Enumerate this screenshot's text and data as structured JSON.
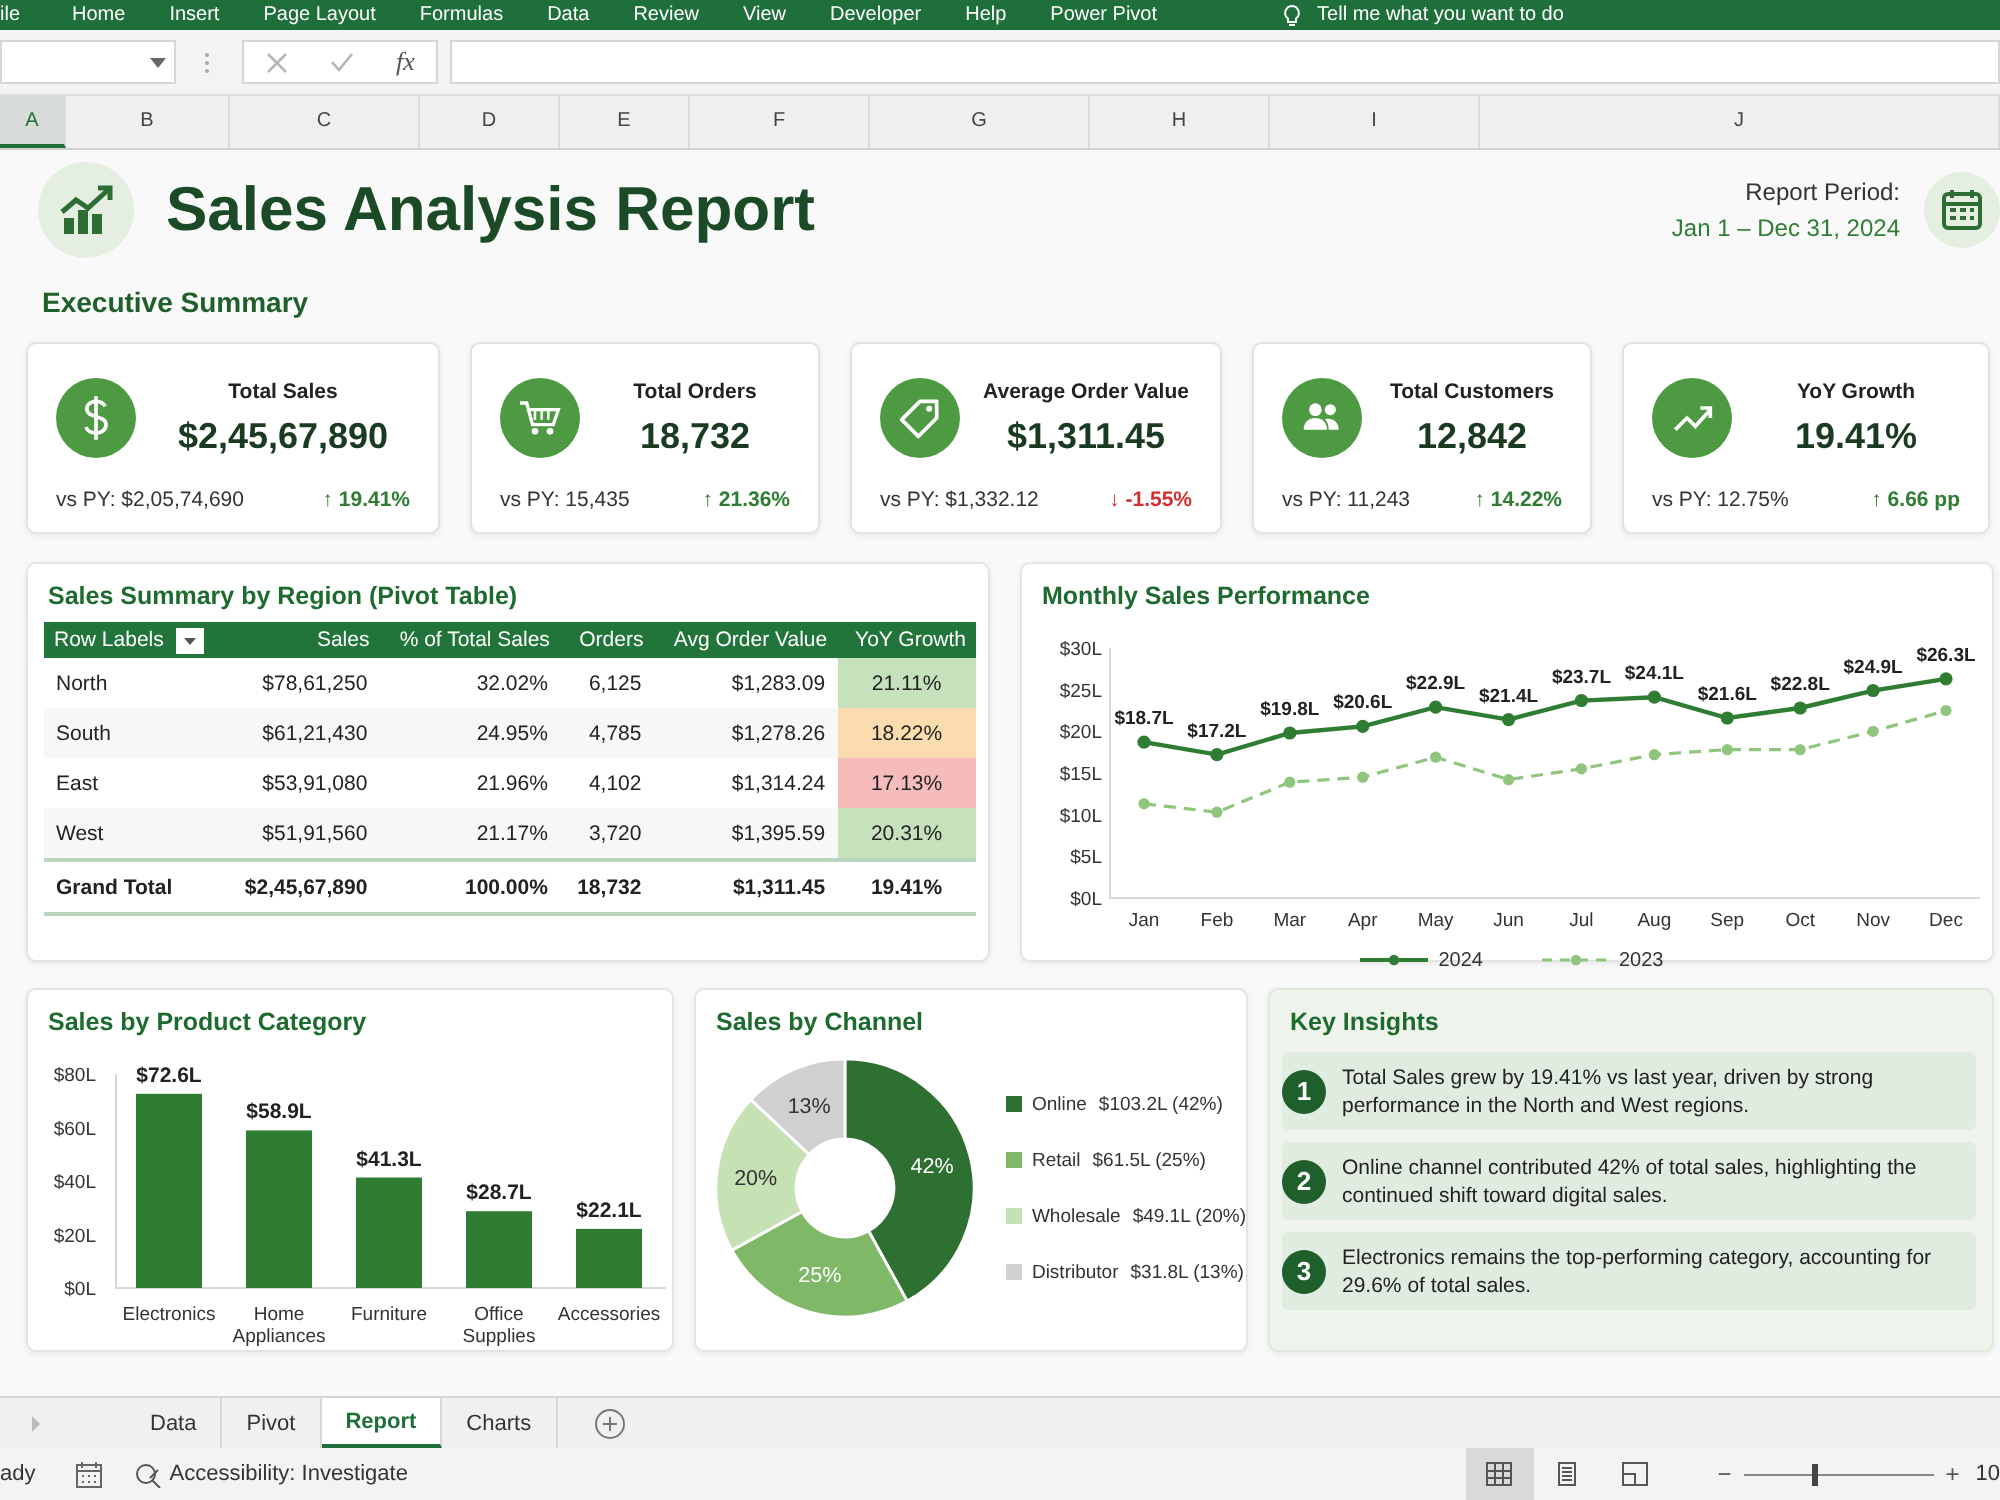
{
  "ribbon": {
    "tabs": [
      "ile",
      "Home",
      "Insert",
      "Page Layout",
      "Formulas",
      "Data",
      "Review",
      "View",
      "Developer",
      "Help",
      "Power Pivot"
    ],
    "tell_me": "Tell me what you want to do"
  },
  "formula_bar": {
    "function_label": "fx"
  },
  "columns": [
    {
      "label": "A",
      "selected": true
    },
    {
      "label": "B",
      "selected": false
    },
    {
      "label": "C",
      "selected": false
    },
    {
      "label": "D",
      "selected": false
    },
    {
      "label": "E",
      "selected": false
    },
    {
      "label": "F",
      "selected": false
    },
    {
      "label": "G",
      "selected": false
    },
    {
      "label": "H",
      "selected": false
    },
    {
      "label": "I",
      "selected": false
    },
    {
      "label": "J",
      "selected": false
    }
  ],
  "header": {
    "title": "Sales Analysis Report",
    "period_label": "Report Period:",
    "period": "Jan 1 – Dec 31, 2024"
  },
  "summary": {
    "title": "Executive Summary",
    "cards": [
      {
        "title": "Total Sales",
        "value": "$2,45,67,890",
        "comparison": "vs PY: $2,05,74,690",
        "change": "↑ 19.41%",
        "color": "#2e7d32"
      },
      {
        "title": "Total Orders",
        "value": "18,732",
        "comparison": "vs PY: 15,435",
        "change": "↑ 21.36%",
        "color": "#2e7d32"
      },
      {
        "title": "Average Order Value",
        "value": "$1,311.45",
        "comparison": "vs PY: $1,332.12",
        "change": "↓ -1.55%",
        "color": "#d32f2f"
      },
      {
        "title": "Total Customers",
        "value": "12,842",
        "comparison": "vs PY: 11,243",
        "change": "↑ 14.22%",
        "color": "#2e7d32"
      },
      {
        "title": "YoY Growth",
        "value": "19.41%",
        "comparison": "vs PY: 12.75%",
        "change": "↑ 6.66 pp",
        "color": "#2e7d32"
      }
    ]
  },
  "pivot": {
    "title": "Sales Summary by Region (Pivot Table)",
    "columns": [
      "Row Labels",
      "Sales",
      "% of Total Sales",
      "Orders",
      "Avg Order Value",
      "YoY Growth"
    ],
    "rows": [
      {
        "cells": [
          "North",
          "$78,61,250",
          "32.02%",
          "6,125",
          "$1,283.09",
          "21.11%"
        ],
        "color": "#c6e2bc"
      },
      {
        "cells": [
          "South",
          "$61,21,430",
          "24.95%",
          "4,785",
          "$1,278.26",
          "18.22%"
        ],
        "color": "#fbdcaf"
      },
      {
        "cells": [
          "East",
          "$53,91,080",
          "21.96%",
          "4,102",
          "$1,314.24",
          "17.13%"
        ],
        "color": "#f6bcbc"
      },
      {
        "cells": [
          "West",
          "$51,91,560",
          "21.17%",
          "3,720",
          "$1,395.59",
          "20.31%"
        ],
        "color": "#c6e2bc"
      }
    ],
    "total": [
      "Grand Total",
      "$2,45,67,890",
      "100.00%",
      "18,732",
      "$1,311.45",
      "19.41%"
    ]
  },
  "monthly": {
    "title": "Monthly Sales Performance",
    "chart_data": {
      "type": "line",
      "categories": [
        "Jan",
        "Feb",
        "Mar",
        "Apr",
        "May",
        "Jun",
        "Jul",
        "Aug",
        "Sep",
        "Oct",
        "Nov",
        "Dec"
      ],
      "ylim": [
        0,
        30
      ],
      "yticks": [
        {
          "value": 0,
          "label": "$0L"
        },
        {
          "value": 5,
          "label": "$5L"
        },
        {
          "value": 10,
          "label": "$10L"
        },
        {
          "value": 15,
          "label": "$15L"
        },
        {
          "value": 20,
          "label": "$20L"
        },
        {
          "value": 25,
          "label": "$25L"
        },
        {
          "value": 30,
          "label": "$30L"
        }
      ],
      "series": [
        {
          "name": "2024",
          "color": "#2e7d32",
          "line_style": "solid",
          "marker": "circle",
          "values": [
            18.7,
            17.2,
            19.8,
            20.6,
            22.9,
            21.4,
            23.7,
            24.1,
            21.6,
            22.8,
            24.9,
            26.3
          ]
        },
        {
          "name": "2023",
          "color": "#8fc57c",
          "line_style": "dashed",
          "marker": "circle",
          "values": [
            11.3,
            10.3,
            13.9,
            14.5,
            16.9,
            14.2,
            15.5,
            17.2,
            17.8,
            17.8,
            20.0,
            22.5
          ]
        }
      ],
      "legend": true,
      "value_labels": [
        "$18.7L",
        "$17.2L",
        "$19.8L",
        "$20.6L",
        "$22.9L",
        "$21.4L",
        "$23.7L",
        "$24.1L",
        "$21.6L",
        "$22.8L",
        "$24.9L",
        "$26.3L"
      ]
    }
  },
  "category": {
    "title": "Sales by Product Category",
    "chart_data": {
      "type": "bar",
      "categories": [
        "Electronics",
        "Home Appliances",
        "Furniture",
        "Office Supplies",
        "Accessories"
      ],
      "ylim": [
        0,
        80
      ],
      "yticks": [
        {
          "value": 0,
          "label": "$0L"
        },
        {
          "value": 20,
          "label": "$20L"
        },
        {
          "value": 40,
          "label": "$40L"
        },
        {
          "value": 60,
          "label": "$60L"
        },
        {
          "value": 80,
          "label": "$80L"
        }
      ],
      "values": [
        72.6,
        58.9,
        41.3,
        28.7,
        22.1
      ],
      "value_labels": [
        "$72.6L",
        "$58.9L",
        "$41.3L",
        "$28.7L",
        "$22.1L"
      ]
    }
  },
  "channel": {
    "title": "Sales by Channel",
    "chart_data": {
      "type": "donut",
      "categories": [
        "Online",
        "Retail",
        "Wholesale",
        "Distributor"
      ],
      "values": [
        42,
        25,
        20,
        13
      ],
      "colors": [
        "#2e7031",
        "#7fb866",
        "#c6e1b3",
        "#d0d0d0"
      ],
      "value_labels": [
        "42%",
        "25%",
        "20%",
        "13%"
      ],
      "legend": true
    },
    "legend_amounts": [
      "$103.2L (42%)",
      "$61.5L (25%)",
      "$49.1L (20%)",
      "$31.8L (13%)"
    ]
  },
  "insights": {
    "title": "Key Insights",
    "items": [
      {
        "number": "1",
        "text": "Total Sales grew by 19.41% vs last year, driven by strong performance in the North and West regions."
      },
      {
        "number": "2",
        "text": "Online channel contributed 42% of total sales, highlighting the continued shift toward digital sales."
      },
      {
        "number": "3",
        "text": "Electronics remains the top-performing category, accounting for 29.6% of total sales."
      }
    ]
  },
  "sheet_tabs": [
    {
      "label": "Data",
      "selected": false
    },
    {
      "label": "Pivot",
      "selected": false
    },
    {
      "label": "Report",
      "selected": true
    },
    {
      "label": "Charts",
      "selected": false
    }
  ],
  "status": {
    "mode": "ady",
    "accessibility": "Accessibility: Investigate",
    "views": [
      {
        "selected": true
      },
      {
        "selected": false
      },
      {
        "selected": false
      }
    ],
    "zoom": {
      "minus": "−",
      "plus": "+",
      "level": 0.37,
      "reading": "10"
    }
  }
}
